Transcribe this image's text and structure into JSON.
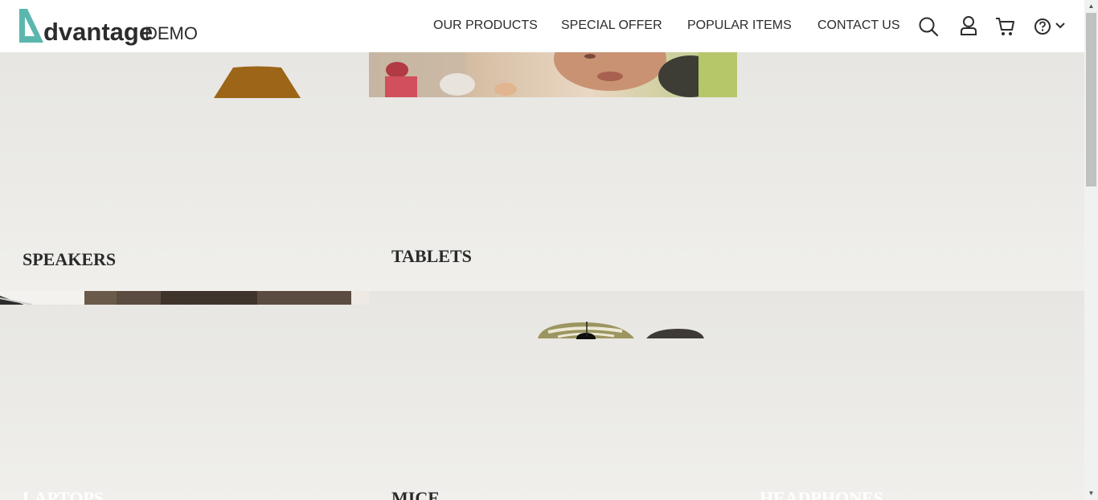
{
  "brand": {
    "name": "dvantage",
    "suffix": "DEMO",
    "accent_color": "#5bb7ad"
  },
  "nav": {
    "items": [
      {
        "label": "OUR PRODUCTS"
      },
      {
        "label": "SPECIAL OFFER"
      },
      {
        "label": "POPULAR ITEMS"
      },
      {
        "label": "CONTACT US"
      }
    ],
    "icons": [
      "search-icon",
      "user-icon",
      "cart-icon",
      "help-icon",
      "chevron-down-icon"
    ]
  },
  "categories": {
    "speakers": {
      "label": "SPEAKERS"
    },
    "tablets": {
      "label": "TABLETS"
    },
    "laptops": {
      "label": "LAPTOPS"
    },
    "mice": {
      "label": "MICE"
    },
    "headphones": {
      "label": "HEADPHONES"
    }
  }
}
